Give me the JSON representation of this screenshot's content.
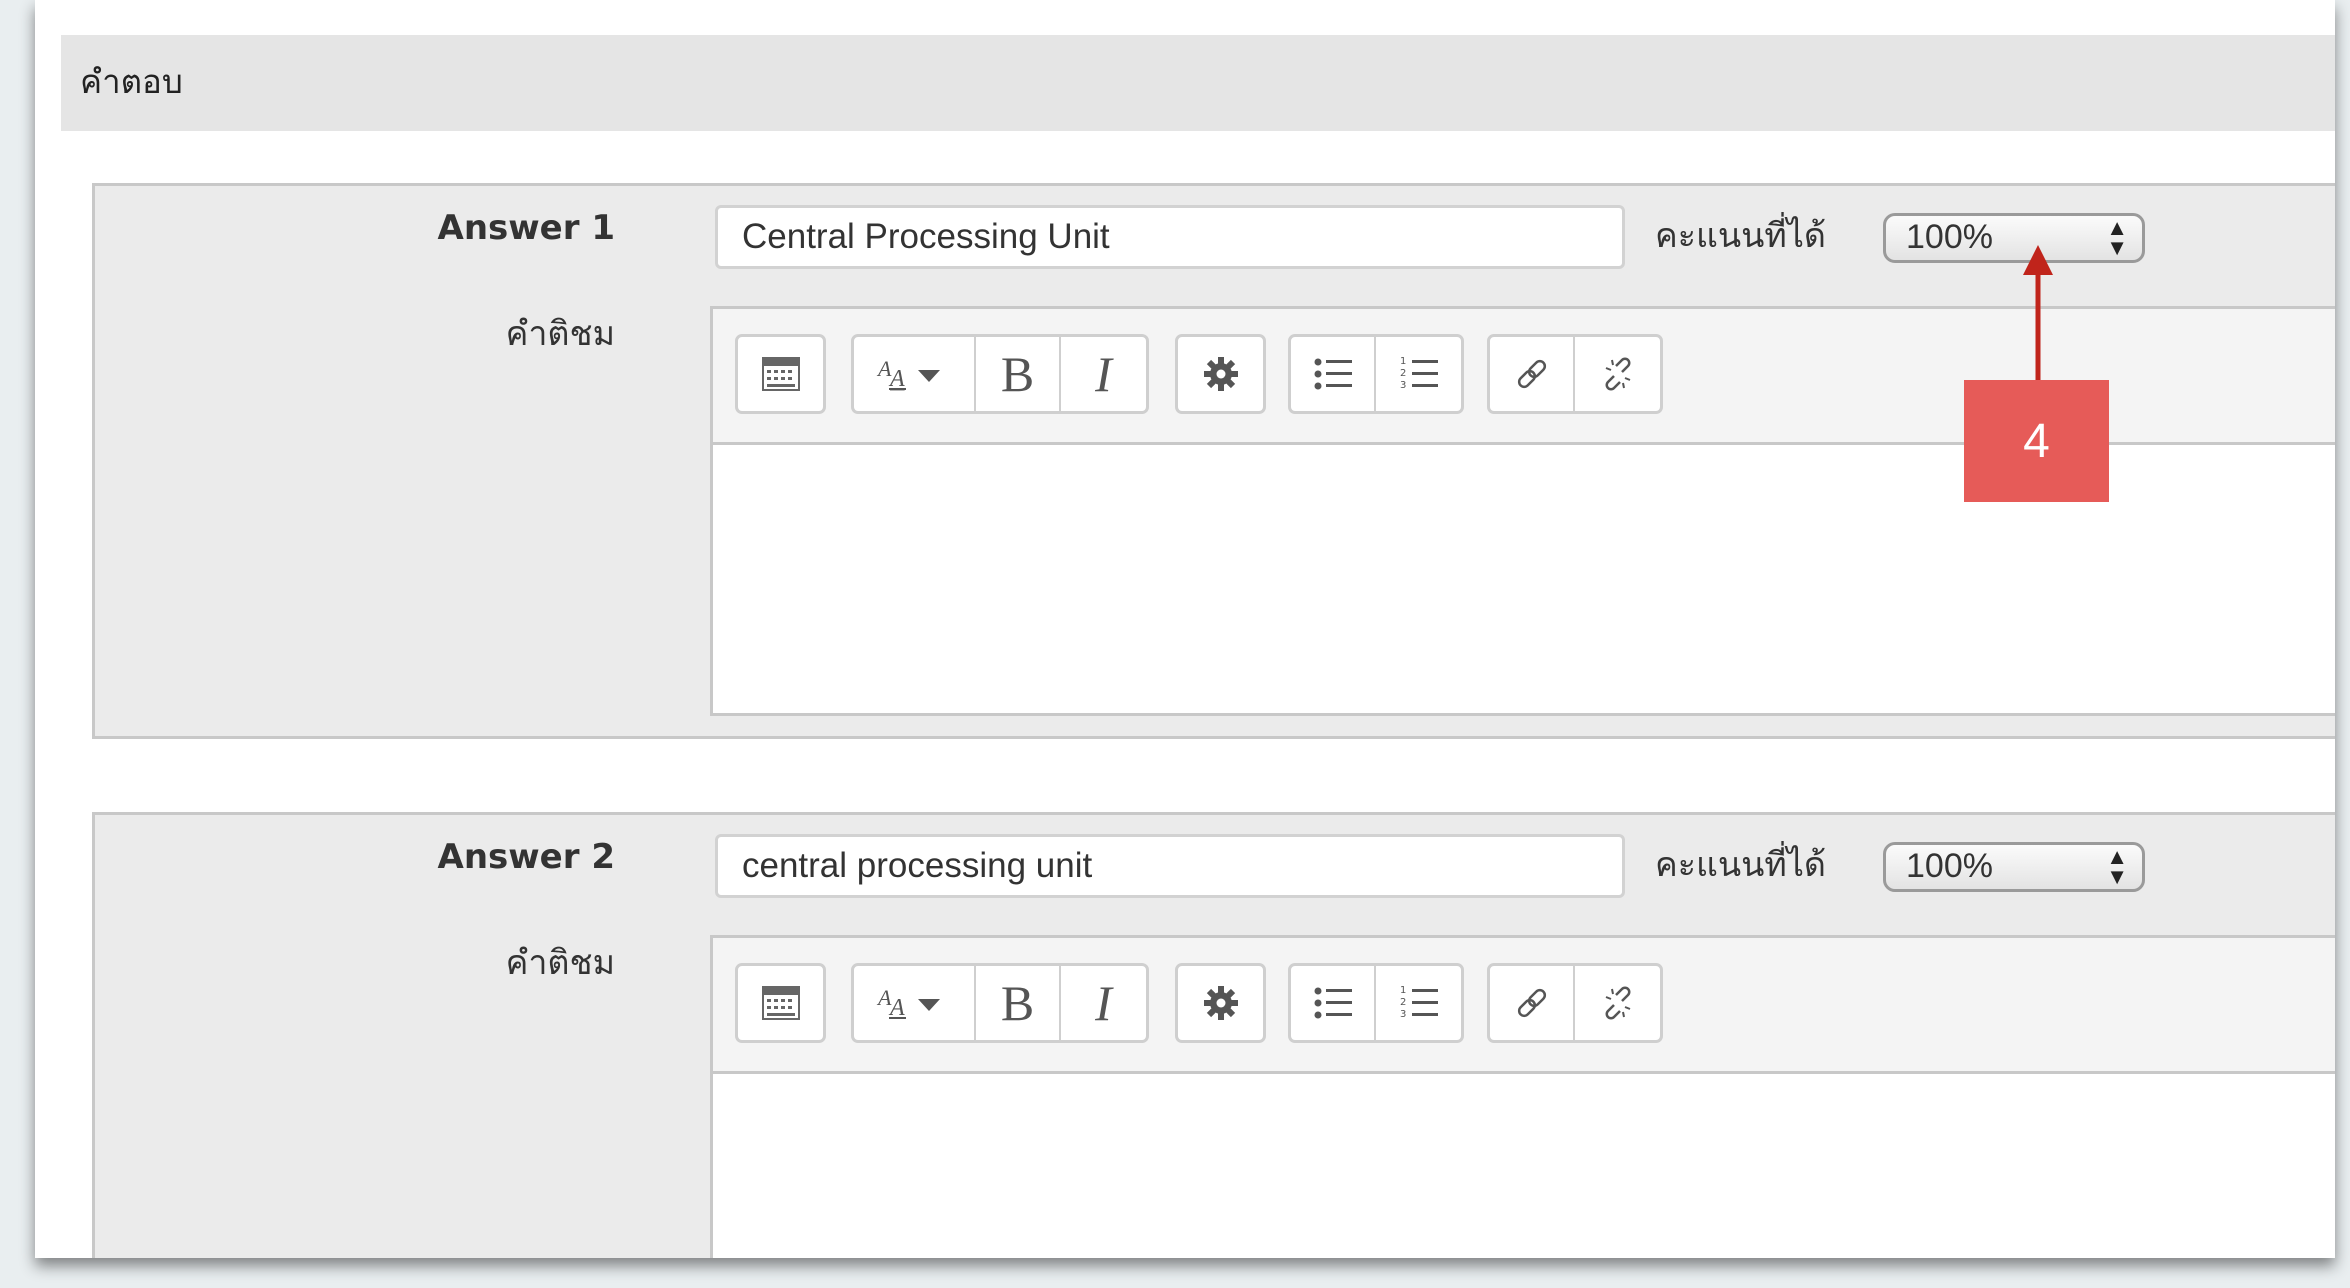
{
  "section": {
    "title": "คำตอบ"
  },
  "answers": [
    {
      "label": "Answer 1",
      "value": "Central Processing Unit",
      "grade_label": "คะแนนที่ได้",
      "grade_value": "100%",
      "feedback_label": "คำติชม"
    },
    {
      "label": "Answer 2",
      "value": "central processing unit",
      "grade_label": "คะแนนที่ได้",
      "grade_value": "100%",
      "feedback_label": "คำติชม"
    }
  ],
  "callout": {
    "number": "4",
    "color": "#e65b58",
    "arrow_color": "#c0241b"
  },
  "toolbar_icons": [
    "toolbar-toggle-icon",
    "font-style-icon",
    "bold-icon",
    "italic-icon",
    "settings-gear-icon",
    "bullet-list-icon",
    "numbered-list-icon",
    "link-icon",
    "unlink-icon"
  ]
}
